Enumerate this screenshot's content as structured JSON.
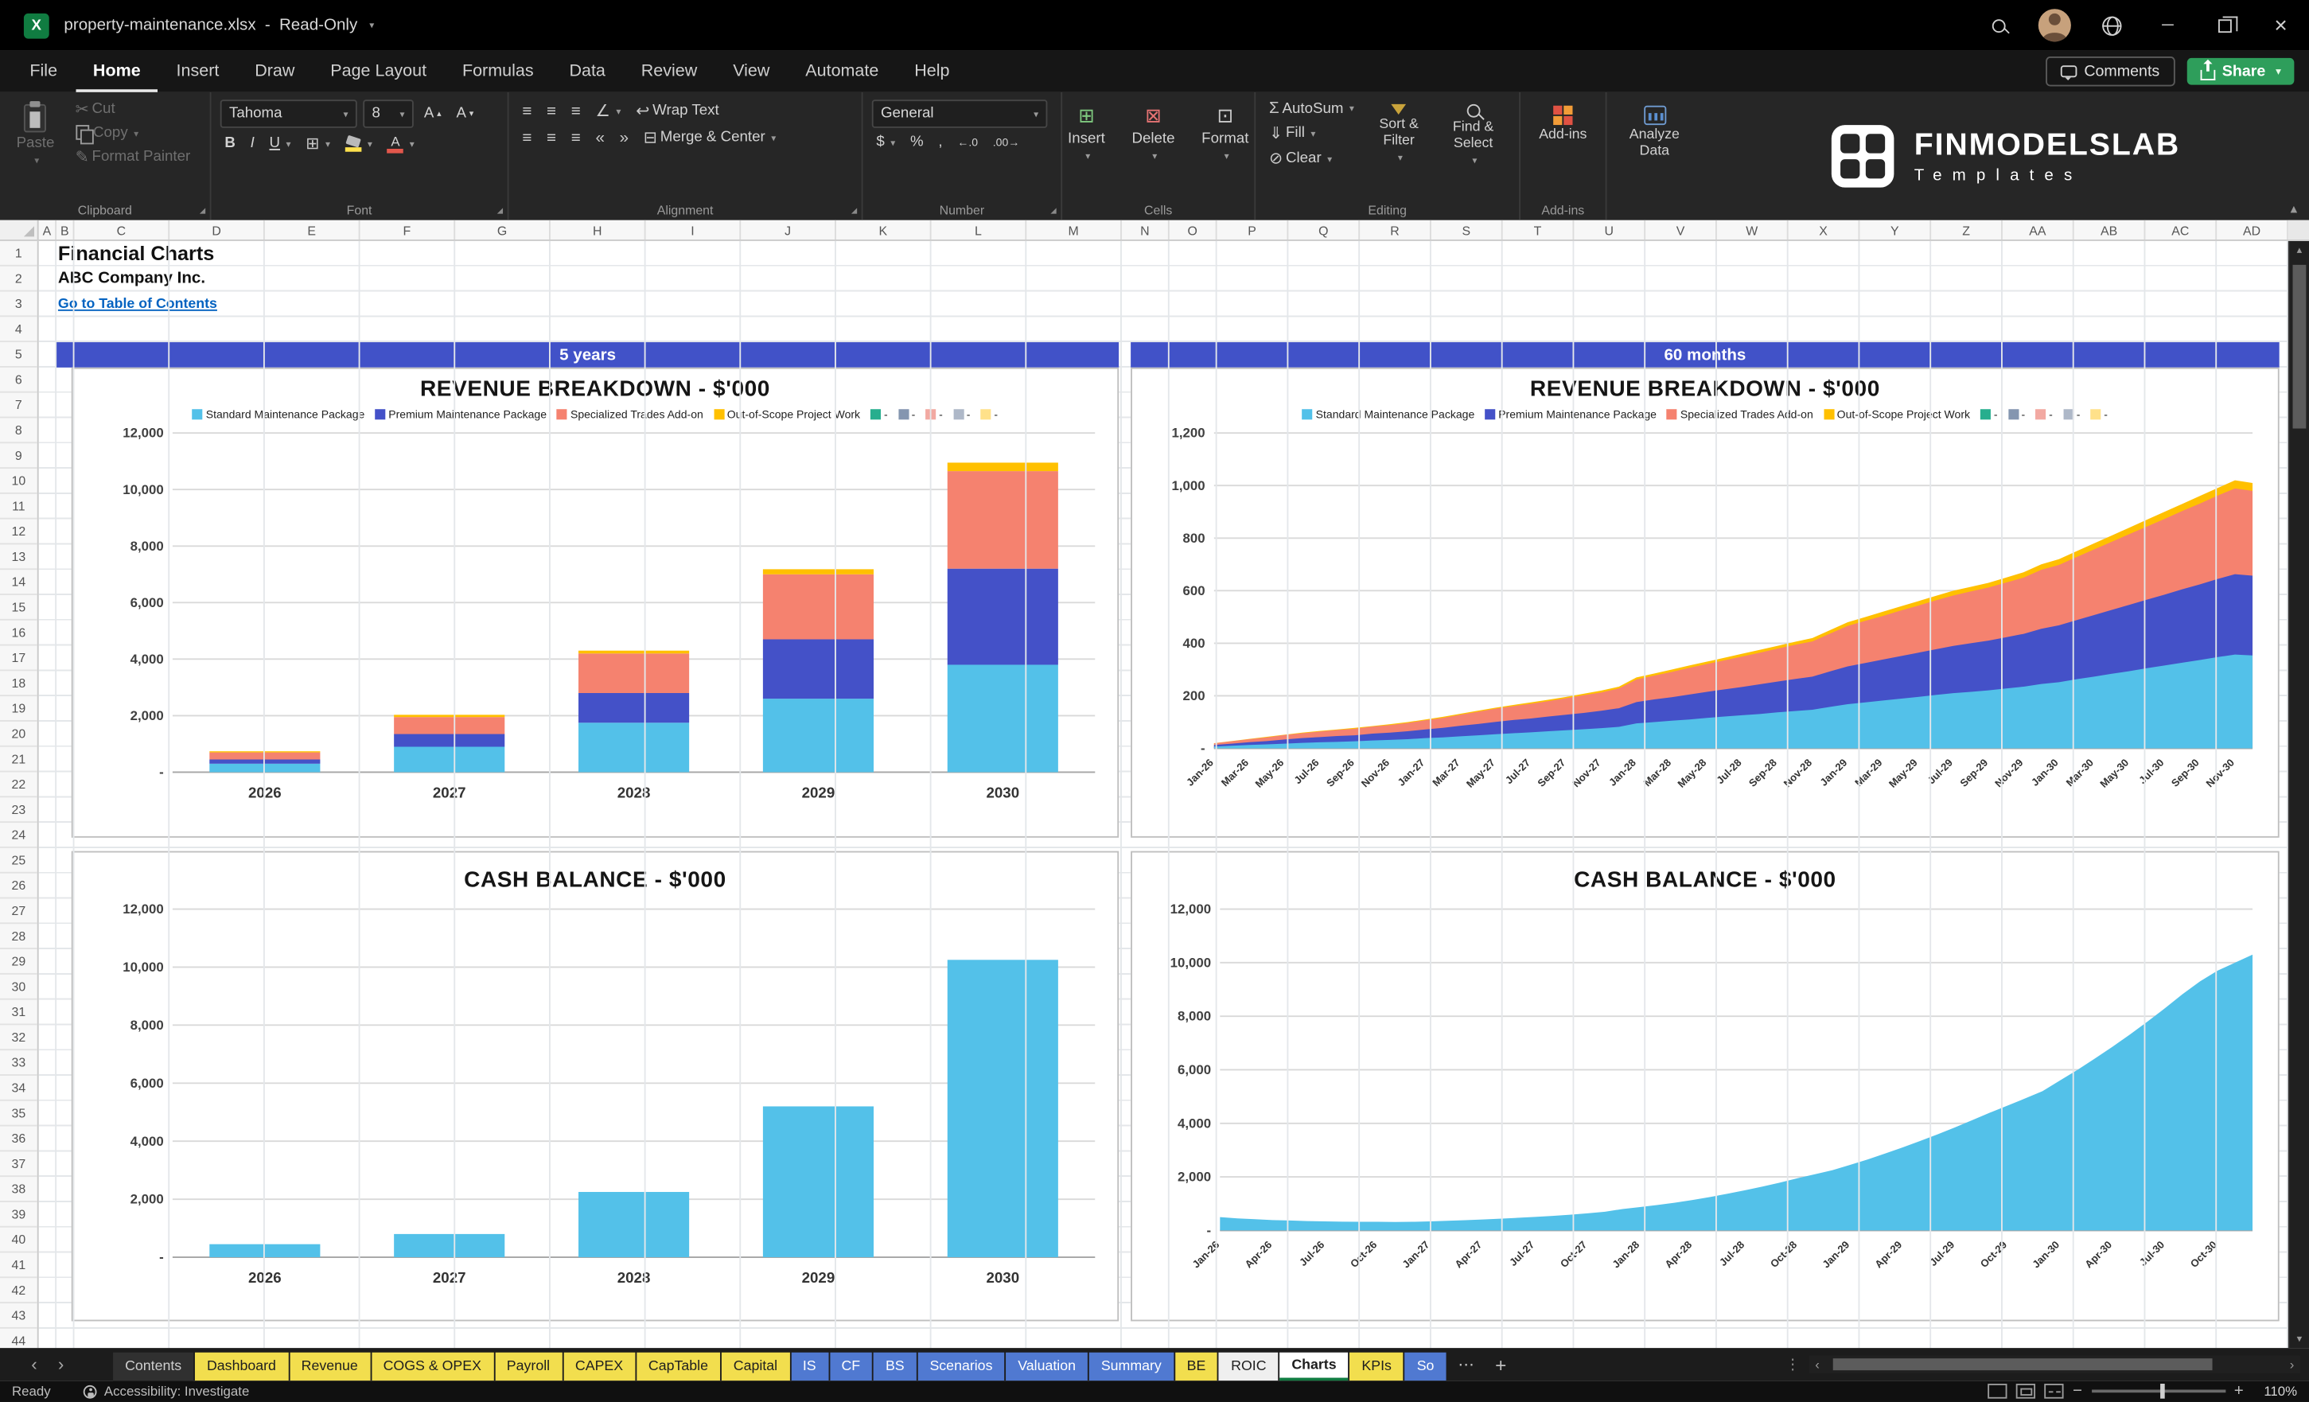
{
  "titlebar": {
    "filename": "property-maintenance.xlsx",
    "separator": "-",
    "mode": "Read-Only"
  },
  "menu": {
    "items": [
      "File",
      "Home",
      "Insert",
      "Draw",
      "Page Layout",
      "Formulas",
      "Data",
      "Review",
      "View",
      "Automate",
      "Help"
    ],
    "active": "Home",
    "comments_label": "Comments",
    "share_label": "Share"
  },
  "ribbon": {
    "paste": "Paste",
    "cut": "Cut",
    "copy": "Copy",
    "format_painter": "Format Painter",
    "font_name": "Tahoma",
    "font_size": "8",
    "wrap_text": "Wrap Text",
    "merge_center": "Merge & Center",
    "number_format": "General",
    "insert": "Insert",
    "delete": "Delete",
    "format": "Format",
    "autosum": "AutoSum",
    "fill": "Fill",
    "clear": "Clear",
    "sort_filter": "Sort & Filter",
    "find_select": "Find & Select",
    "addins": "Add-ins",
    "analyze_data": "Analyze Data",
    "groups": {
      "clipboard": "Clipboard",
      "font": "Font",
      "alignment": "Alignment",
      "number": "Number",
      "cells": "Cells",
      "editing": "Editing",
      "addins": "Add-ins"
    }
  },
  "brand": {
    "name": "FINMODELSLAB",
    "tagline": "Templates"
  },
  "grid": {
    "column_labels": [
      "A",
      "B",
      "C",
      "D",
      "E",
      "F",
      "G",
      "H",
      "I",
      "J",
      "K",
      "L",
      "M",
      "N",
      "O",
      "P",
      "Q",
      "R",
      "S",
      "T",
      "U",
      "V",
      "W",
      "X",
      "Y",
      "Z",
      "AA",
      "AB",
      "AC",
      "AD"
    ],
    "row_count": 44,
    "cells": {
      "title": "Financial Charts",
      "company": "ABC Company Inc.",
      "link": "Go to Table of Contents"
    }
  },
  "banners": {
    "left": "5 years",
    "right": "60 months"
  },
  "chart_data": [
    {
      "id": "revenue-annual",
      "type": "stacked-bar",
      "title": "REVENUE BREAKDOWN - $'000",
      "legend": true,
      "categories": [
        "2026",
        "2027",
        "2028",
        "2029",
        "2030"
      ],
      "series": [
        {
          "name": "Standard Maintenance Package",
          "color": "#53C1E9",
          "values": [
            300,
            900,
            1750,
            2600,
            3800
          ]
        },
        {
          "name": "Premium Maintenance Package",
          "color": "#4451C8",
          "values": [
            150,
            450,
            1050,
            2100,
            3400
          ]
        },
        {
          "name": "Specialized Trades Add-on",
          "color": "#F5826F",
          "values": [
            250,
            600,
            1400,
            2300,
            3450
          ]
        },
        {
          "name": "Out-of-Scope Project Work",
          "color": "#FFC000",
          "values": [
            40,
            80,
            100,
            180,
            300
          ]
        }
      ],
      "extra_legend": [
        "#27AE8E",
        "#8496B0",
        "#F2A9A2",
        "#AEB8C8",
        "#FFE18A"
      ],
      "ylim": [
        0,
        12000
      ],
      "yticks": [
        "-",
        "2,000",
        "4,000",
        "6,000",
        "8,000",
        "10,000",
        "12,000"
      ],
      "grid": true,
      "legend_position": "top"
    },
    {
      "id": "revenue-monthly",
      "type": "stacked-area",
      "title": "REVENUE BREAKDOWN - $'000",
      "legend": true,
      "x_step": 2,
      "x_labels": [
        "Jan-26",
        "Mar-26",
        "May-26",
        "Jul-26",
        "Sep-26",
        "Nov-26",
        "Jan-27",
        "Mar-27",
        "May-27",
        "Jul-27",
        "Sep-27",
        "Nov-27",
        "Jan-28",
        "Mar-28",
        "May-28",
        "Jul-28",
        "Sep-28",
        "Nov-28",
        "Jan-29",
        "Mar-29",
        "May-29",
        "Jul-29",
        "Sep-29",
        "Nov-29",
        "Jan-30",
        "Mar-30",
        "May-30",
        "Jul-30",
        "Sep-30",
        "Nov-30"
      ],
      "series": [
        {
          "name": "Standard Maintenance Package",
          "color": "#53C1E9",
          "values": [
            7,
            10,
            13,
            15,
            18,
            21,
            23,
            25,
            27,
            30,
            32,
            35,
            39,
            42,
            46,
            50,
            54,
            58,
            61,
            65,
            69,
            73,
            77,
            82,
            95,
            100,
            105,
            110,
            116,
            121,
            126,
            131,
            137,
            142,
            147,
            158,
            168,
            175,
            182,
            189,
            196,
            203,
            210,
            215,
            221,
            228,
            235,
            245,
            252,
            263,
            273,
            284,
            294,
            305,
            315,
            326,
            336,
            347,
            357,
            354
          ]
        },
        {
          "name": "Premium Maintenance Package",
          "color": "#4451C8",
          "values": [
            6,
            8,
            11,
            13,
            16,
            18,
            20,
            22,
            23,
            26,
            28,
            30,
            33,
            36,
            40,
            43,
            47,
            50,
            53,
            56,
            59,
            62,
            66,
            71,
            81,
            86,
            90,
            95,
            99,
            104,
            108,
            113,
            117,
            122,
            126,
            135,
            144,
            150,
            156,
            162,
            168,
            174,
            180,
            185,
            189,
            195,
            201,
            210,
            216,
            225,
            234,
            243,
            252,
            261,
            270,
            279,
            288,
            297,
            306,
            303
          ]
        },
        {
          "name": "Specialized Trades Add-on",
          "color": "#F5826F",
          "values": [
            6,
            9,
            11,
            14,
            17,
            19,
            21,
            23,
            25,
            27,
            29,
            32,
            35,
            38,
            42,
            46,
            50,
            53,
            56,
            59,
            63,
            67,
            70,
            75,
            86,
            91,
            96,
            101,
            106,
            110,
            115,
            120,
            125,
            130,
            134,
            144,
            154,
            160,
            166,
            173,
            179,
            186,
            192,
            197,
            202,
            208,
            214,
            224,
            230,
            240,
            250,
            259,
            269,
            278,
            288,
            298,
            307,
            317,
            326,
            323
          ]
        },
        {
          "name": "Out-of-Scope Project Work",
          "color": "#FFC000",
          "values": [
            1,
            1,
            1,
            2,
            1,
            2,
            2,
            2,
            3,
            2,
            3,
            3,
            3,
            4,
            4,
            5,
            4,
            4,
            5,
            5,
            5,
            6,
            7,
            7,
            8,
            8,
            9,
            9,
            9,
            10,
            11,
            11,
            11,
            11,
            13,
            13,
            14,
            15,
            16,
            16,
            17,
            17,
            18,
            18,
            18,
            19,
            20,
            21,
            22,
            22,
            23,
            24,
            25,
            26,
            27,
            27,
            29,
            29,
            31,
            30
          ]
        }
      ],
      "extra_legend": [
        "#27AE8E",
        "#8496B0",
        "#F2A9A2",
        "#AEB8C8",
        "#FFE18A"
      ],
      "ylim": [
        0,
        1200
      ],
      "yticks": [
        "-",
        "200",
        "400",
        "600",
        "800",
        "1,000",
        "1,200"
      ],
      "grid": true,
      "legend_position": "top"
    },
    {
      "id": "cash-annual",
      "type": "bar",
      "title": "CASH BALANCE - $'000",
      "categories": [
        "2026",
        "2027",
        "2028",
        "2029",
        "2030"
      ],
      "color": "#53C1E9",
      "values": [
        450,
        800,
        2250,
        5200,
        10250
      ],
      "ylim": [
        0,
        12000
      ],
      "yticks": [
        "-",
        "2,000",
        "4,000",
        "6,000",
        "8,000",
        "10,000",
        "12,000"
      ],
      "grid": true
    },
    {
      "id": "cash-monthly",
      "type": "area",
      "title": "CASH BALANCE - $'000",
      "x_step": 3,
      "x_labels": [
        "Jan-26",
        "Apr-26",
        "Jul-26",
        "Oct-26",
        "Jan-27",
        "Apr-27",
        "Jul-27",
        "Oct-27",
        "Jan-28",
        "Apr-28",
        "Jul-28",
        "Oct-28",
        "Jan-29",
        "Apr-29",
        "Jul-29",
        "Oct-29",
        "Jan-30",
        "Apr-30",
        "Jul-30",
        "Oct-30"
      ],
      "color": "#53C1E9",
      "values": [
        500,
        450,
        420,
        390,
        370,
        350,
        340,
        330,
        325,
        320,
        318,
        320,
        340,
        360,
        385,
        410,
        440,
        470,
        505,
        545,
        590,
        640,
        700,
        800,
        870,
        950,
        1040,
        1140,
        1250,
        1370,
        1500,
        1640,
        1790,
        1950,
        2100,
        2250,
        2450,
        2650,
        2870,
        3100,
        3340,
        3590,
        3850,
        4120,
        4400,
        4660,
        4930,
        5200,
        5600,
        6000,
        6420,
        6860,
        7320,
        7800,
        8300,
        8820,
        9300,
        9700,
        10000,
        10300
      ],
      "ylim": [
        0,
        12000
      ],
      "yticks": [
        "-",
        "2,000",
        "4,000",
        "6,000",
        "8,000",
        "10,000",
        "12,000"
      ],
      "grid": true
    }
  ],
  "sheet_tabs": {
    "tabs": [
      {
        "label": "Contents",
        "color": "default"
      },
      {
        "label": "Dashboard",
        "color": "yellow"
      },
      {
        "label": "Revenue",
        "color": "yellow"
      },
      {
        "label": "COGS & OPEX",
        "color": "yellow"
      },
      {
        "label": "Payroll",
        "color": "yellow"
      },
      {
        "label": "CAPEX",
        "color": "yellow"
      },
      {
        "label": "CapTable",
        "color": "yellow"
      },
      {
        "label": "Capital",
        "color": "yellow"
      },
      {
        "label": "IS",
        "color": "blue"
      },
      {
        "label": "CF",
        "color": "blue"
      },
      {
        "label": "BS",
        "color": "blue"
      },
      {
        "label": "Scenarios",
        "color": "blue"
      },
      {
        "label": "Valuation",
        "color": "blue"
      },
      {
        "label": "Summary",
        "color": "blue"
      },
      {
        "label": "BE",
        "color": "yellow"
      },
      {
        "label": "ROIC",
        "color": "white"
      },
      {
        "label": "Charts",
        "color": "active",
        "active": true
      },
      {
        "label": "KPIs",
        "color": "yellow"
      },
      {
        "label": "So",
        "color": "blue"
      }
    ]
  },
  "status_bar": {
    "mode": "Ready",
    "accessibility": "Accessibility: Investigate",
    "zoom_level": "110%"
  },
  "icons": {
    "search": "css-magnifier",
    "avatar": "css-person-circle",
    "globe": "css-globe",
    "minimize": "─",
    "restore": "css-overlap-squares",
    "close": "×",
    "comment": "css-speech-bubble",
    "share": "css-box-up-arrow",
    "cut": "✂",
    "autosum": "Σ",
    "dialog_launcher": "◢"
  }
}
